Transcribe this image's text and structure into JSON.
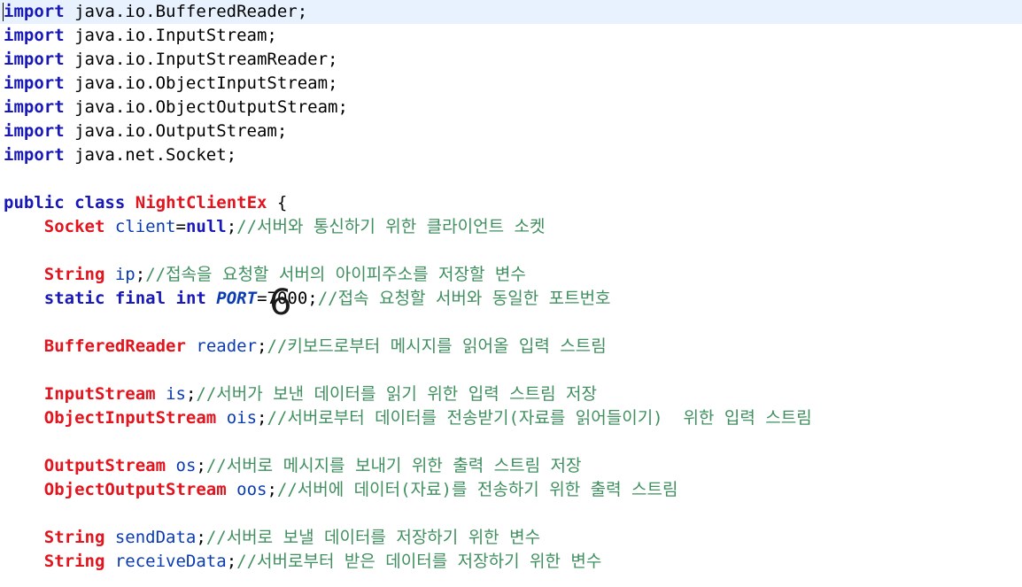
{
  "overlay_digit": "6",
  "code_lines": [
    [
      {
        "t": "import",
        "c": "kw"
      },
      {
        "t": " java.io.BufferedReader;",
        "c": "plain"
      }
    ],
    [
      {
        "t": "import",
        "c": "kw"
      },
      {
        "t": " java.io.InputStream;",
        "c": "plain"
      }
    ],
    [
      {
        "t": "import",
        "c": "kw"
      },
      {
        "t": " java.io.InputStreamReader;",
        "c": "plain"
      }
    ],
    [
      {
        "t": "import",
        "c": "kw"
      },
      {
        "t": " java.io.ObjectInputStream;",
        "c": "plain"
      }
    ],
    [
      {
        "t": "import",
        "c": "kw"
      },
      {
        "t": " java.io.ObjectOutputStream;",
        "c": "plain"
      }
    ],
    [
      {
        "t": "import",
        "c": "kw"
      },
      {
        "t": " java.io.OutputStream;",
        "c": "plain"
      }
    ],
    [
      {
        "t": "import",
        "c": "kw"
      },
      {
        "t": " java.net.Socket;",
        "c": "plain"
      }
    ],
    [],
    [
      {
        "t": "public",
        "c": "kw"
      },
      {
        "t": " ",
        "c": "plain"
      },
      {
        "t": "class",
        "c": "kw"
      },
      {
        "t": " ",
        "c": "plain"
      },
      {
        "t": "NightClientEx",
        "c": "type"
      },
      {
        "t": " {",
        "c": "plain"
      }
    ],
    [
      {
        "t": "    ",
        "c": "plain"
      },
      {
        "t": "Socket",
        "c": "type"
      },
      {
        "t": " ",
        "c": "plain"
      },
      {
        "t": "client",
        "c": "field"
      },
      {
        "t": "=",
        "c": "plain"
      },
      {
        "t": "null",
        "c": "kw"
      },
      {
        "t": ";",
        "c": "plain"
      },
      {
        "t": "//서버와 통신하기 위한 클라이언트 소켓",
        "c": "comment"
      }
    ],
    [],
    [
      {
        "t": "    ",
        "c": "plain"
      },
      {
        "t": "String",
        "c": "type"
      },
      {
        "t": " ",
        "c": "plain"
      },
      {
        "t": "ip",
        "c": "field"
      },
      {
        "t": ";",
        "c": "plain"
      },
      {
        "t": "//접속을 요청할 서버의 아이피주소를 저장할 변수",
        "c": "comment"
      }
    ],
    [
      {
        "t": "    ",
        "c": "plain"
      },
      {
        "t": "static",
        "c": "kw"
      },
      {
        "t": " ",
        "c": "plain"
      },
      {
        "t": "final",
        "c": "kw"
      },
      {
        "t": " ",
        "c": "plain"
      },
      {
        "t": "int",
        "c": "kw"
      },
      {
        "t": " ",
        "c": "plain"
      },
      {
        "t": "PORT",
        "c": "const"
      },
      {
        "t": "=7000;",
        "c": "plain"
      },
      {
        "t": "//접속 요청할 서버와 동일한 포트번호",
        "c": "comment"
      }
    ],
    [],
    [
      {
        "t": "    ",
        "c": "plain"
      },
      {
        "t": "BufferedReader",
        "c": "type"
      },
      {
        "t": " ",
        "c": "plain"
      },
      {
        "t": "reader",
        "c": "field"
      },
      {
        "t": ";",
        "c": "plain"
      },
      {
        "t": "//키보드로부터 메시지를 읽어올 입력 스트림",
        "c": "comment"
      }
    ],
    [],
    [
      {
        "t": "    ",
        "c": "plain"
      },
      {
        "t": "InputStream",
        "c": "type"
      },
      {
        "t": " ",
        "c": "plain"
      },
      {
        "t": "is",
        "c": "field"
      },
      {
        "t": ";",
        "c": "plain"
      },
      {
        "t": "//서버가 보낸 데이터를 읽기 위한 입력 스트림 저장",
        "c": "comment"
      }
    ],
    [
      {
        "t": "    ",
        "c": "plain"
      },
      {
        "t": "ObjectInputStream",
        "c": "type"
      },
      {
        "t": " ",
        "c": "plain"
      },
      {
        "t": "ois",
        "c": "field"
      },
      {
        "t": ";",
        "c": "plain"
      },
      {
        "t": "//서버로부터 데이터를 전송받기(자료를 읽어들이기)  위한 입력 스트림",
        "c": "comment"
      }
    ],
    [],
    [
      {
        "t": "    ",
        "c": "plain"
      },
      {
        "t": "OutputStream",
        "c": "type"
      },
      {
        "t": " ",
        "c": "plain"
      },
      {
        "t": "os",
        "c": "field"
      },
      {
        "t": ";",
        "c": "plain"
      },
      {
        "t": "//서버로 메시지를 보내기 위한 출력 스트림 저장",
        "c": "comment"
      }
    ],
    [
      {
        "t": "    ",
        "c": "plain"
      },
      {
        "t": "ObjectOutputStream",
        "c": "type"
      },
      {
        "t": " ",
        "c": "plain"
      },
      {
        "t": "oos",
        "c": "field"
      },
      {
        "t": ";",
        "c": "plain"
      },
      {
        "t": "//서버에 데이터(자료)를 전송하기 위한 출력 스트림",
        "c": "comment"
      }
    ],
    [],
    [
      {
        "t": "    ",
        "c": "plain"
      },
      {
        "t": "String",
        "c": "type"
      },
      {
        "t": " ",
        "c": "plain"
      },
      {
        "t": "sendData",
        "c": "field"
      },
      {
        "t": ";",
        "c": "plain"
      },
      {
        "t": "//서버로 보낼 데이터를 저장하기 위한 변수",
        "c": "comment"
      }
    ],
    [
      {
        "t": "    ",
        "c": "plain"
      },
      {
        "t": "String",
        "c": "type"
      },
      {
        "t": " ",
        "c": "plain"
      },
      {
        "t": "receiveData",
        "c": "field"
      },
      {
        "t": ";",
        "c": "plain"
      },
      {
        "t": "//서버로부터 받은 데이터를 저장하기 위한 변수",
        "c": "comment"
      }
    ]
  ],
  "colors": {
    "keyword": "#1818b8",
    "type": "#e2141e",
    "field": "#0a3bb0",
    "comment": "#3f8f5f",
    "current_line": "#e8f2fe"
  }
}
